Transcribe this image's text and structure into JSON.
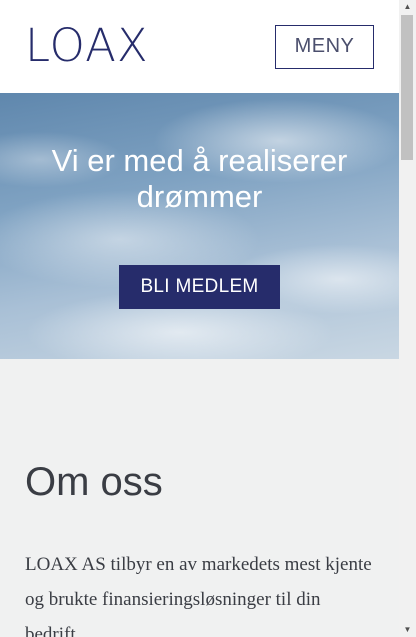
{
  "header": {
    "logo": "LOAX",
    "menu_label": "MENY"
  },
  "hero": {
    "title": "Vi er med å realiserer drømmer",
    "cta_label": "BLI MEDLEM"
  },
  "about": {
    "title": "Om oss",
    "text": "LOAX AS tilbyr en av markedets mest kjente og brukte finansieringsløsninger til din bedrift."
  },
  "scrollbar": {
    "up_arrow": "▲",
    "down_arrow": "▼"
  },
  "colors": {
    "brand": "#262c6b",
    "background": "#f0f1f1",
    "text": "#3a3d44"
  }
}
